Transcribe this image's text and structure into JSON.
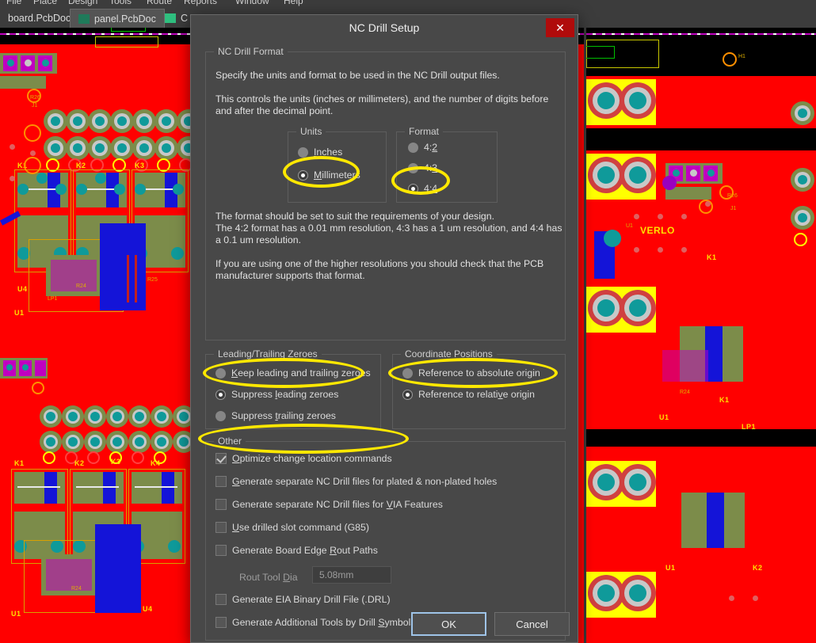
{
  "menubar": {
    "items": [
      "File",
      "Place",
      "Design",
      "Tools",
      "Route",
      "Reports",
      "Window",
      "Help"
    ]
  },
  "tabs": [
    {
      "label": "board.PcbDoc",
      "icon": "pcb-doc-icon",
      "active": false
    },
    {
      "label": "panel.PcbDoc",
      "icon": "pcb-doc-icon",
      "active": true
    },
    {
      "label": "C",
      "icon": "pcb-doc-icon",
      "active": false
    }
  ],
  "dialog": {
    "title": "NC Drill Setup",
    "close_icon": "close-icon",
    "close_glyph": "✕",
    "format_group": {
      "label": "NC Drill Format",
      "p1": "Specify the units and format to be used in the NC Drill output files.",
      "p2": "This controls the units (inches or millimeters), and the number of digits before and after the decimal point.",
      "p3_line1": "The format should be set to suit the requirements of your design.",
      "p3_line2": "The 4:2 format has a 0.01 mm resolution, 4:3 has a 1 um resolution, and 4:4 has",
      "p3_line3": "a 0.1 um resolution.",
      "p4": "If you are using one of the higher resolutions you should check that the PCB manufacturer supports that format."
    },
    "units_group": {
      "label": "Units",
      "options": [
        {
          "label": "Inches",
          "mnemonic": "I",
          "selected": false
        },
        {
          "label": "Millimeters",
          "mnemonic": "M",
          "selected": true
        }
      ]
    },
    "format_options_group": {
      "label": "Format",
      "options": [
        {
          "label": "4:2",
          "mnemonic": "2",
          "selected": false
        },
        {
          "label": "4:3",
          "mnemonic": "3",
          "selected": false
        },
        {
          "label": "4:4",
          "mnemonic": "4",
          "selected": true
        }
      ]
    },
    "zeroes_group": {
      "label": "Leading/Trailing Zeroes",
      "options": [
        {
          "label": "Keep leading and trailing zeroes",
          "mnemonic": "K",
          "selected": false
        },
        {
          "label": "Suppress leading zeroes",
          "mnemonic": "l",
          "selected": true
        },
        {
          "label": "Suppress trailing zeroes",
          "mnemonic": "t",
          "selected": false
        }
      ]
    },
    "coords_group": {
      "label": "Coordinate Positions",
      "options": [
        {
          "label": "Reference to absolute origin",
          "mnemonic": "",
          "selected": false
        },
        {
          "label": "Reference to relative origin",
          "mnemonic": "v",
          "selected": true
        }
      ]
    },
    "other_group": {
      "label": "Other",
      "checkboxes": [
        {
          "label": "Optimize change location commands",
          "mnemonic": "O",
          "checked": true
        },
        {
          "label": "Generate separate NC Drill files for plated & non-plated holes",
          "mnemonic": "G",
          "checked": false
        },
        {
          "label": "Generate separate NC Drill files for VIA Features",
          "mnemonic": "VI",
          "checked": false
        },
        {
          "label": "Use drilled slot command (G85)",
          "mnemonic": "U",
          "checked": false
        },
        {
          "label": "Generate Board Edge Rout Paths",
          "mnemonic": "R",
          "checked": false
        },
        {
          "label": "Generate EIA Binary Drill File (.DRL)",
          "mnemonic": "",
          "checked": false
        },
        {
          "label": "Generate Additional Tools by Drill Symbols",
          "mnemonic": "S",
          "checked": false
        }
      ],
      "rout_tool": {
        "label": "Rout Tool Dia",
        "mnemonic": "D",
        "value": "5.08mm",
        "enabled": false
      }
    },
    "buttons": {
      "ok": "OK",
      "cancel": "Cancel"
    }
  },
  "annotations": {
    "color": "#ffe800",
    "ellipses": [
      "millimeters-radio",
      "format-4-4-radio",
      "suppress-leading-zeroes-radio",
      "reference-relative-origin-radio",
      "optimize-change-location-checkbox"
    ]
  },
  "background": {
    "app": "pcb-editor",
    "view": "pcb-layout-panel",
    "silkscreen": [
      "VERLO",
      "K1",
      "K2",
      "K3",
      "U1",
      "U4",
      "J1",
      "H1",
      "R26"
    ]
  },
  "colors": {
    "dialog_bg": "#484848",
    "title_bg": "#484848",
    "close_red": "#b00b0b",
    "accent_focus": "#9fc4e8",
    "pcb_copper": "#ff0000",
    "pcb_pad": "#0f9a9a",
    "pcb_trace": "#1414d8",
    "pcb_silk": "#ffe000",
    "annotation": "#ffe800"
  }
}
